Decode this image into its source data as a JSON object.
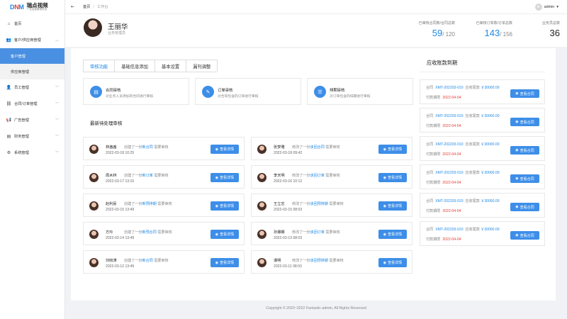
{
  "logo": {
    "mark_d": "D",
    "mark_n": "N",
    "mark_m": "M",
    "title": "瑞点视频",
    "subtitle": "广告运营管理系统"
  },
  "sidebar": {
    "home": "首页",
    "customer_group": "客户/供应商管理",
    "customer_mgmt": "客户管理",
    "supplier_mgmt": "供应商管理",
    "staff": "员工管理",
    "contract": "合同/订单管理",
    "ad": "广告管理",
    "finance": "财务管理",
    "system": "系统管理"
  },
  "topbar": {
    "collapse_icon": "indent-icon",
    "crumb_home": "首页",
    "crumb_sep": "/",
    "crumb_current": "工作台",
    "user": "admin"
  },
  "header": {
    "name": "王丽华",
    "role": "业务管理员",
    "stats": [
      {
        "label": "已审核合同数/合同总数",
        "value": "59",
        "total": "/ 120"
      },
      {
        "label": "已审核订单数/订单总数",
        "value": "143",
        "total": "/ 156"
      },
      {
        "label": "业务员总数",
        "value": "36",
        "total": ""
      }
    ]
  },
  "tabs": [
    "审核功能",
    "基础信息添加",
    "基本设置",
    "漏刊调整"
  ],
  "quick": [
    {
      "title": "合同审核",
      "desc": "对业务人员添加的合同进行审核"
    },
    {
      "title": "订单审核",
      "desc": "对合同包含的订单进行审核"
    },
    {
      "title": "排期审核",
      "desc": "对订单包含的排期进行审核"
    }
  ],
  "pending_title": "最新待处理审核",
  "btn_detail": "查看详情",
  "tasks": [
    {
      "name": "林茜茜",
      "pre": "创建了一份",
      "link": "新合同",
      "post": "需要审核",
      "date": "2022-03-18 10:25"
    },
    {
      "name": "张梦雅",
      "pre": "修改了一份",
      "link": "该回合同",
      "post": "需要审核",
      "date": "2022-03-18 09:42"
    },
    {
      "name": "周木林",
      "pre": "创建了一份",
      "link": "新订单",
      "post": "需要审核",
      "date": "2022-03-17 13:10"
    },
    {
      "name": "李天明",
      "pre": "修改了一份",
      "link": "该回订单",
      "post": "需要审核",
      "date": "2022-03-16 10:12"
    },
    {
      "name": "赵利民",
      "pre": "创建了一份",
      "link": "新预排期",
      "post": "需要审核",
      "date": "2022-03-15 13:49"
    },
    {
      "name": "王立志",
      "pre": "修改了一份",
      "link": "该回预排期",
      "post": "需要审核",
      "date": "2022-03-15 08:03"
    },
    {
      "name": "方玲",
      "pre": "创建了一份",
      "link": "新预合同",
      "post": "需要审核",
      "date": "2022-03-14 13:49"
    },
    {
      "name": "孙娜娜",
      "pre": "修改了一份",
      "link": "该回订单",
      "post": "需要审核",
      "date": "2022-03-13 08:03"
    },
    {
      "name": "刘晓涛",
      "pre": "创建了一份",
      "link": "新合同",
      "post": "需要审核",
      "date": "2022-03-12 13:49"
    },
    {
      "name": "谭明",
      "pre": "修改了一份",
      "link": "该回预排期",
      "post": "需要审核",
      "date": "2022-03-11 08:03"
    }
  ],
  "receivable": {
    "title": "应收账款到期",
    "contract_label": "合同",
    "amount_label": "应收尾款",
    "due_label": "付款期限",
    "btn": "查看合同",
    "items": [
      {
        "no": "XMT-202203-010",
        "amount": "￥30000.00",
        "due": "2022-04-04"
      },
      {
        "no": "XMT-202203-010",
        "amount": "￥30000.00",
        "due": "2022-04-04"
      },
      {
        "no": "XMT-202203-010",
        "amount": "￥30000.00",
        "due": "2022-04-04"
      },
      {
        "no": "XMT-202203-010",
        "amount": "￥30000.00",
        "due": "2022-04-04"
      },
      {
        "no": "XMT-202203-010",
        "amount": "￥30000.00",
        "due": "2022-04-04"
      },
      {
        "no": "XMT-202203-010",
        "amount": "￥30000.00",
        "due": "2022-04-04"
      }
    ]
  },
  "footer": "Copyright © 2020~2022 Fantastic-admin, All Rights Reserved"
}
